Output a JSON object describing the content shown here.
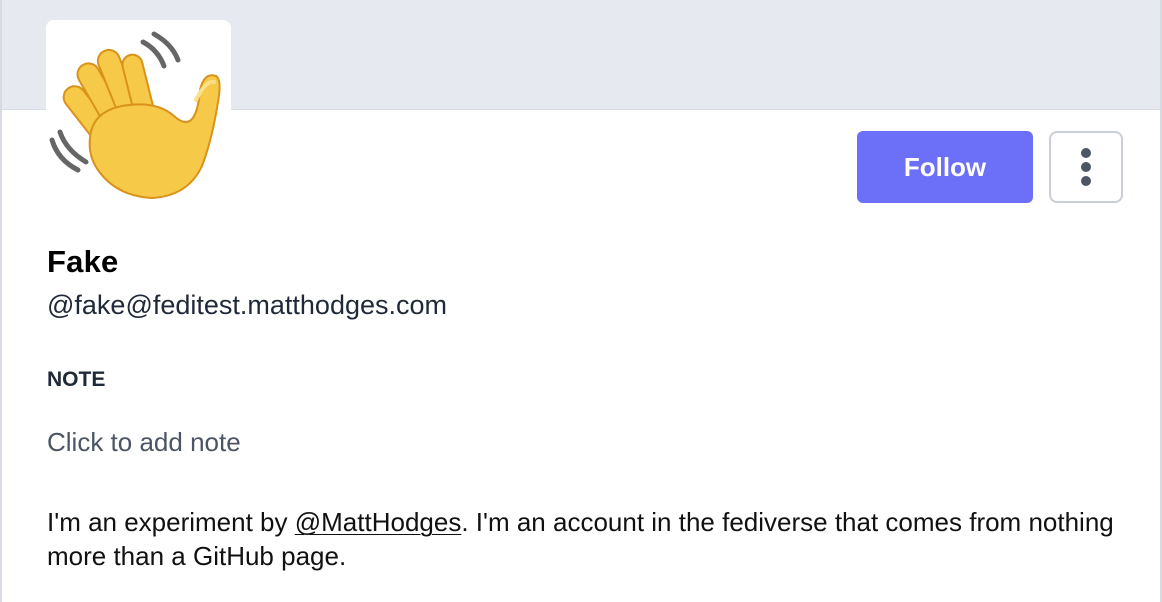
{
  "profile": {
    "display_name": "Fake",
    "handle": "@fake@feditest.matthodges.com",
    "avatar_icon": "waving-hand-icon"
  },
  "actions": {
    "follow_label": "Follow",
    "more_icon": "vertical-ellipsis-icon"
  },
  "note": {
    "label": "NOTE",
    "placeholder": "Click to add note"
  },
  "bio": {
    "before_mention": "I'm an experiment by ",
    "mention": "@MattHodges",
    "after_mention": ". I'm an account in the fediverse that comes from nothing more than a GitHub page."
  },
  "colors": {
    "accent": "#6c6ff8",
    "banner": "#e6e9ef"
  }
}
